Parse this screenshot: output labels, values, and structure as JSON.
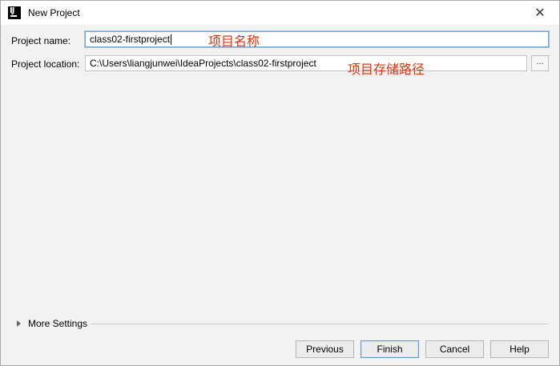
{
  "window": {
    "title": "New Project",
    "app_icon_text": "IJ",
    "close_glyph": "✕"
  },
  "form": {
    "project_name_label": "Project name:",
    "project_name_value": "class02-firstproject",
    "project_location_label": "Project location:",
    "project_location_value": "C:\\Users\\liangjunwei\\IdeaProjects\\class02-firstproject",
    "browse_label": "..."
  },
  "annotations": {
    "name_note": "项目名称",
    "location_note": "项目存储路径",
    "color": "#e8300c"
  },
  "more_settings": {
    "label": "More Settings"
  },
  "buttons": {
    "previous": "Previous",
    "finish": "Finish",
    "cancel": "Cancel",
    "help": "Help"
  }
}
